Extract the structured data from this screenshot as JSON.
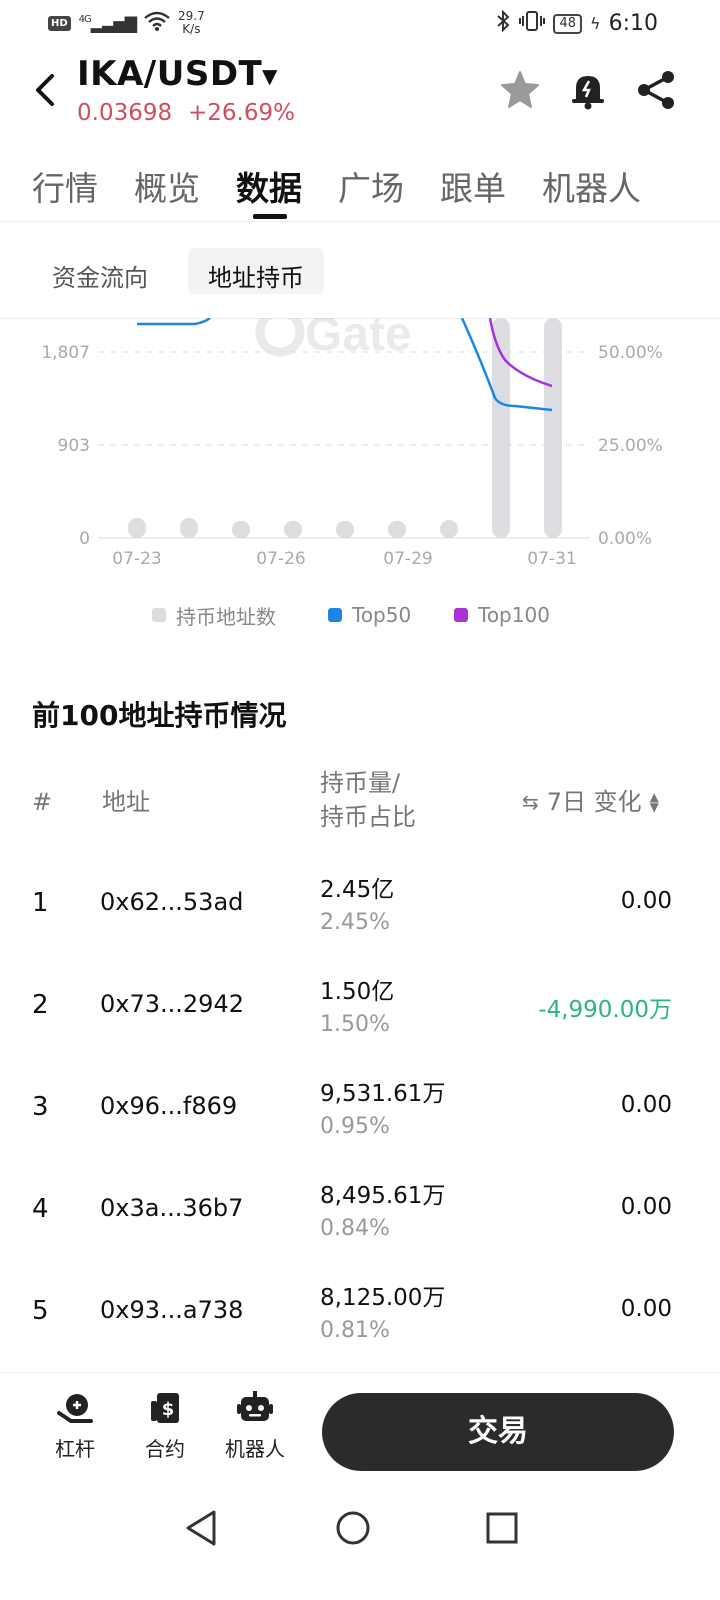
{
  "status_bar": {
    "hd": "HD",
    "net": "4G",
    "speed_value": "29.7",
    "speed_unit": "K/s",
    "battery": "48",
    "time": "6:10"
  },
  "header": {
    "pair": "IKA/USDT",
    "price": "0.03698",
    "change": "+26.69%"
  },
  "tabs": [
    "行情",
    "概览",
    "数据",
    "广场",
    "跟单",
    "机器人"
  ],
  "subtabs": [
    "资金流向",
    "地址持币"
  ],
  "chart_data": {
    "type": "line",
    "x_ticks": [
      "07-23",
      "07-26",
      "07-29",
      "07-31"
    ],
    "y_left_ticks": [
      "1,807",
      "903",
      "0"
    ],
    "y_right_ticks": [
      "50.00%",
      "25.00%",
      "0.00%"
    ],
    "legend": [
      "持币地址数",
      "Top50",
      "Top100"
    ],
    "colors": {
      "addresses": "#dcdde0",
      "top50": "#1b86e6",
      "top100": "#a933d6"
    }
  },
  "section": {
    "title": "前100地址持币情况",
    "col_index": "#",
    "col_address": "地址",
    "col_amount_line1": "持币量/",
    "col_amount_line2": "持币占比",
    "col_change": "7日 变化"
  },
  "rows": [
    {
      "index": "1",
      "address": "0x62...53ad",
      "amount": "2.45亿",
      "ratio": "2.45%",
      "change": "0.00"
    },
    {
      "index": "2",
      "address": "0x73...2942",
      "amount": "1.50亿",
      "ratio": "1.50%",
      "change": "-4,990.00万"
    },
    {
      "index": "3",
      "address": "0x96...f869",
      "amount": "9,531.61万",
      "ratio": "0.95%",
      "change": "0.00"
    },
    {
      "index": "4",
      "address": "0x3a...36b7",
      "amount": "8,495.61万",
      "ratio": "0.84%",
      "change": "0.00"
    },
    {
      "index": "5",
      "address": "0x93...a738",
      "amount": "8,125.00万",
      "ratio": "0.81%",
      "change": "0.00"
    }
  ],
  "bottom_bar": {
    "leverage": "杠杆",
    "contract": "合约",
    "robot": "机器人",
    "trade": "交易"
  },
  "colors": {
    "up": "#d24d62",
    "down": "#2fb37f"
  }
}
